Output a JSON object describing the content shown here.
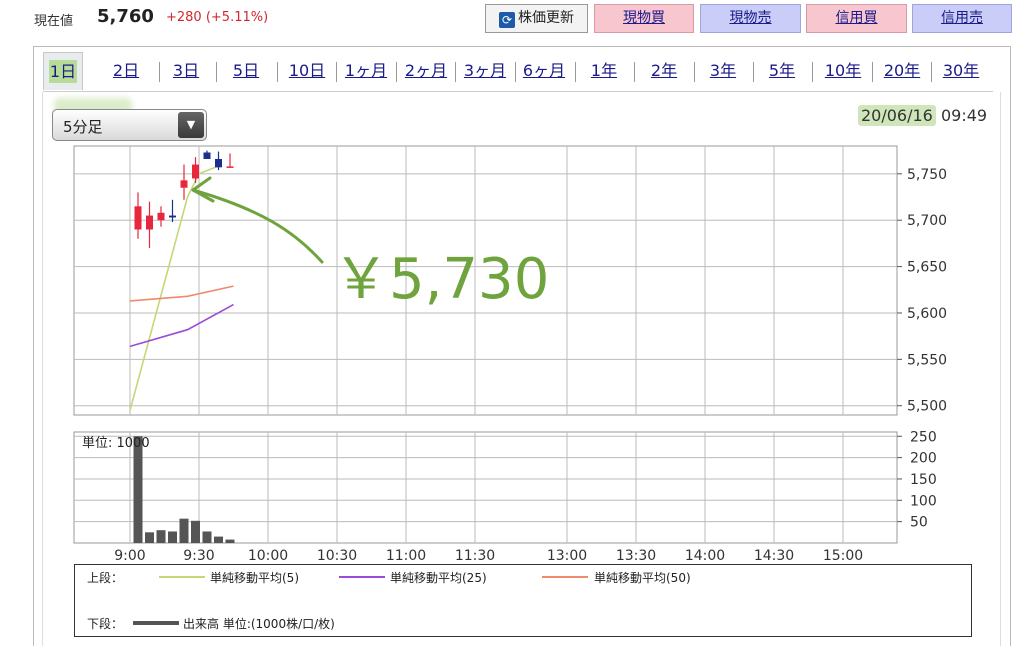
{
  "header": {
    "price_label": "現在値",
    "price_value": "5,760",
    "price_change": "+280 (+5.11%)",
    "buttons": {
      "refresh": "株価更新",
      "spot_buy": "現物買",
      "spot_sell": "現物売",
      "margin_buy": "信用買",
      "margin_sell": "信用売"
    }
  },
  "tabs": [
    "1日",
    "2日",
    "3日",
    "5日",
    "10日",
    "1ヶ月",
    "2ヶ月",
    "3ヶ月",
    "6ヶ月",
    "1年",
    "2年",
    "3年",
    "5年",
    "10年",
    "20年",
    "30年"
  ],
  "active_tab": "1日",
  "interval_select": {
    "value": "5分足",
    "arrow": "▼"
  },
  "datetime": {
    "date": "20/06/16",
    "time": "09:49"
  },
  "annotation": {
    "text": "￥5,730",
    "color": "#6fa33e"
  },
  "colors": {
    "up_candle": "#e8273d",
    "down_candle": "#1b2f8f",
    "sma5": "#c3d877",
    "sma25": "#9b4bd6",
    "sma50": "#ef8a6d",
    "volume": "#555555",
    "grid": "#bbbbbb"
  },
  "chart_data": [
    {
      "type": "candlestick",
      "x_ticks": [
        "9:00",
        "9:30",
        "10:00",
        "10:30",
        "11:00",
        "11:30",
        "13:00",
        "13:30",
        "14:00",
        "14:30",
        "15:00"
      ],
      "y_ticks": [
        "5,750",
        "5,700",
        "5,650",
        "5,600",
        "5,550",
        "5,500"
      ],
      "ylim": [
        5490,
        5780
      ],
      "candles": [
        {
          "t": "9:00",
          "open": 5690,
          "high": 5730,
          "low": 5680,
          "close": 5715
        },
        {
          "t": "9:05",
          "open": 5690,
          "high": 5720,
          "low": 5670,
          "close": 5705
        },
        {
          "t": "9:10",
          "open": 5700,
          "high": 5715,
          "low": 5693,
          "close": 5708
        },
        {
          "t": "9:15",
          "open": 5705,
          "high": 5722,
          "low": 5698,
          "close": 5703
        },
        {
          "t": "9:20",
          "open": 5735,
          "high": 5760,
          "low": 5722,
          "close": 5743
        },
        {
          "t": "9:25",
          "open": 5745,
          "high": 5768,
          "low": 5740,
          "close": 5760
        },
        {
          "t": "9:30",
          "open": 5773,
          "high": 5775,
          "low": 5768,
          "close": 5766
        },
        {
          "t": "9:35",
          "open": 5766,
          "high": 5774,
          "low": 5754,
          "close": 5757
        },
        {
          "t": "9:40",
          "open": 5757,
          "high": 5772,
          "low": 5757,
          "close": 5758
        }
      ],
      "series": [
        {
          "name": "単純移動平均(5)",
          "x": [
            "9:00",
            "9:25",
            "9:30",
            "9:40"
          ],
          "values": [
            5495,
            5725,
            5750,
            5760
          ]
        },
        {
          "name": "単純移動平均(25)",
          "x": [
            "9:00",
            "9:25",
            "9:45"
          ],
          "values": [
            5564,
            5582,
            5609
          ]
        },
        {
          "name": "単純移動平均(50)",
          "x": [
            "9:00",
            "9:25",
            "9:45"
          ],
          "values": [
            5613,
            5618,
            5629
          ]
        }
      ]
    },
    {
      "type": "bar",
      "label": "単位: 1000",
      "y_ticks": [
        "250",
        "200",
        "150",
        "100",
        "50"
      ],
      "ylim": [
        0,
        260
      ],
      "categories": [
        "9:00",
        "9:05",
        "9:10",
        "9:15",
        "9:20",
        "9:25",
        "9:30",
        "9:35",
        "9:40"
      ],
      "values": [
        250,
        25,
        30,
        27,
        57,
        52,
        27,
        15,
        8
      ]
    }
  ],
  "legend": {
    "upper_label": "上段：",
    "lower_label": "下段：",
    "items": [
      "単純移動平均(5)",
      "単純移動平均(25)",
      "単純移動平均(50)"
    ],
    "volume_item": "出来高 単位:(1000株/口/枚)"
  }
}
